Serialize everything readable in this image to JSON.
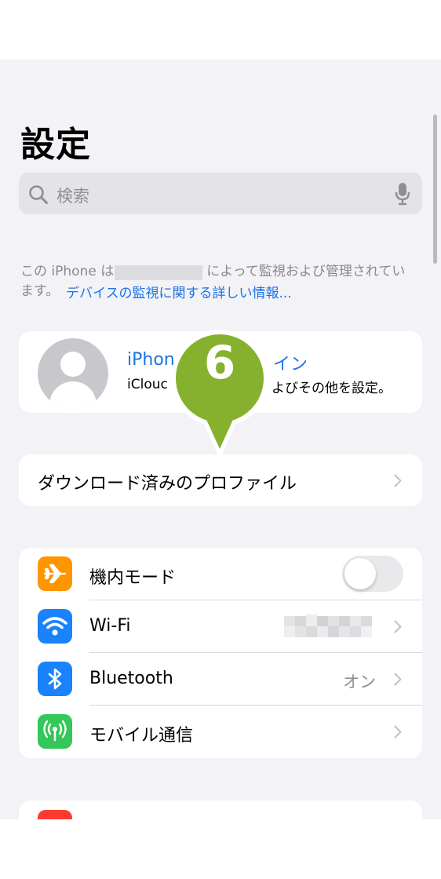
{
  "header": {
    "title": "設定"
  },
  "search": {
    "placeholder": "検索"
  },
  "supervision": {
    "prefix": "この iPhone は",
    "suffix": "によって監視および管理されてい",
    "line2_start": "ます。",
    "link": "デバイスの監視に関する詳しい情報..."
  },
  "profile": {
    "title_left": "iPhon",
    "title_right": "イン",
    "subtitle_left": "iClouc",
    "subtitle_right": "よびその他を設定。"
  },
  "downloaded_profile": {
    "label": "ダウンロード済みのプロファイル"
  },
  "settings": [
    {
      "label": "機内モード",
      "icon": "airplane-icon",
      "color": "#ff9500",
      "toggle": false
    },
    {
      "label": "Wi-Fi",
      "icon": "wifi-icon",
      "color": "#1a82fb"
    },
    {
      "label": "Bluetooth",
      "icon": "bluetooth-icon",
      "color": "#1a82fb",
      "value": "オン"
    },
    {
      "label": "モバイル通信",
      "icon": "cellular-icon",
      "color": "#34c759"
    }
  ],
  "next_group": {
    "icon": "notifications-icon",
    "color": "#ff3b30"
  },
  "callout": {
    "number": "6",
    "color": "#86b12e"
  }
}
